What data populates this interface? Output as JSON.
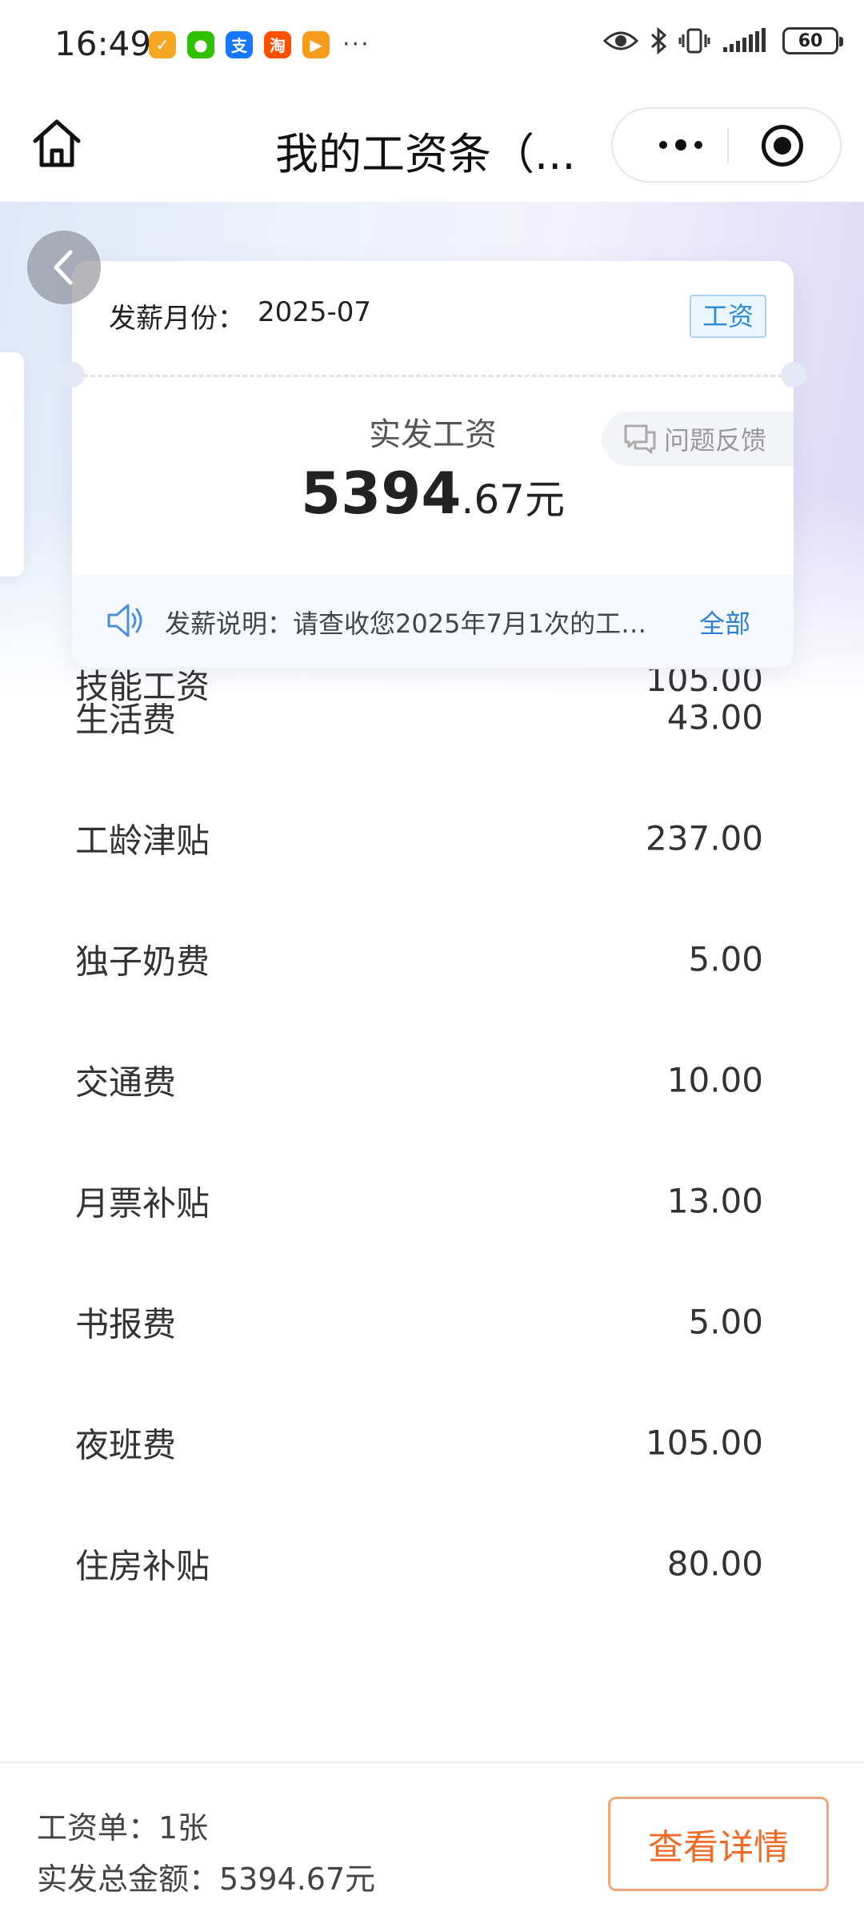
{
  "status_bar": {
    "time": "16:49",
    "more": "···",
    "battery": "60"
  },
  "nav": {
    "title": "我的工资条（..."
  },
  "card": {
    "month_label": "发薪月份：",
    "month_value": "2025-07",
    "tag": "工资",
    "salary_label": "实发工资",
    "salary_integer": "5394",
    "salary_decimal": ".67元",
    "feedback": "问题反馈",
    "notice": "发薪说明：请查收您2025年7月1次的工…",
    "notice_all": "全部"
  },
  "partial_item": {
    "label": "技能工资",
    "value": "105.00"
  },
  "items": [
    {
      "label": "生活费",
      "value": "43.00"
    },
    {
      "label": "工龄津贴",
      "value": "237.00"
    },
    {
      "label": "独子奶费",
      "value": "5.00"
    },
    {
      "label": "交通费",
      "value": "10.00"
    },
    {
      "label": "月票补贴",
      "value": "13.00"
    },
    {
      "label": "书报费",
      "value": "5.00"
    },
    {
      "label": "夜班费",
      "value": "105.00"
    },
    {
      "label": "住房补贴",
      "value": "80.00"
    }
  ],
  "bottom": {
    "count": "工资单：1张",
    "total": "实发总金额：5394.67元",
    "detail_button": "查看详情"
  }
}
